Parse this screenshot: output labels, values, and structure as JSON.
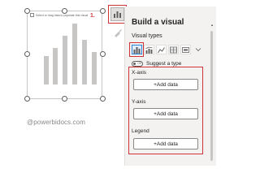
{
  "canvas": {
    "visual_hint": "Select or drag data to populate this visual",
    "step_marker": "1.",
    "watermark": "@powerbidocs.com"
  },
  "pane": {
    "title": "Build a visual",
    "visual_types_label": "Visual types",
    "visual_types": [
      {
        "name": "stacked-column-chart",
        "selected": true
      },
      {
        "name": "line-and-column-chart",
        "selected": false
      },
      {
        "name": "line-chart",
        "selected": false
      },
      {
        "name": "table",
        "selected": false
      },
      {
        "name": "card",
        "selected": false
      },
      {
        "name": "more-visuals-chevron",
        "selected": false
      }
    ],
    "suggest_toggle_state": "Off",
    "suggest_label": "Suggest a type",
    "wells": [
      {
        "label": "X-axis",
        "button": "+Add data"
      },
      {
        "label": "Y-axis",
        "button": "+Add data"
      },
      {
        "label": "Legend",
        "button": "+Add data"
      }
    ]
  },
  "colors": {
    "highlight": "#d13438",
    "pane_background": "#f3f2f1",
    "accent": "#2b88d8"
  }
}
